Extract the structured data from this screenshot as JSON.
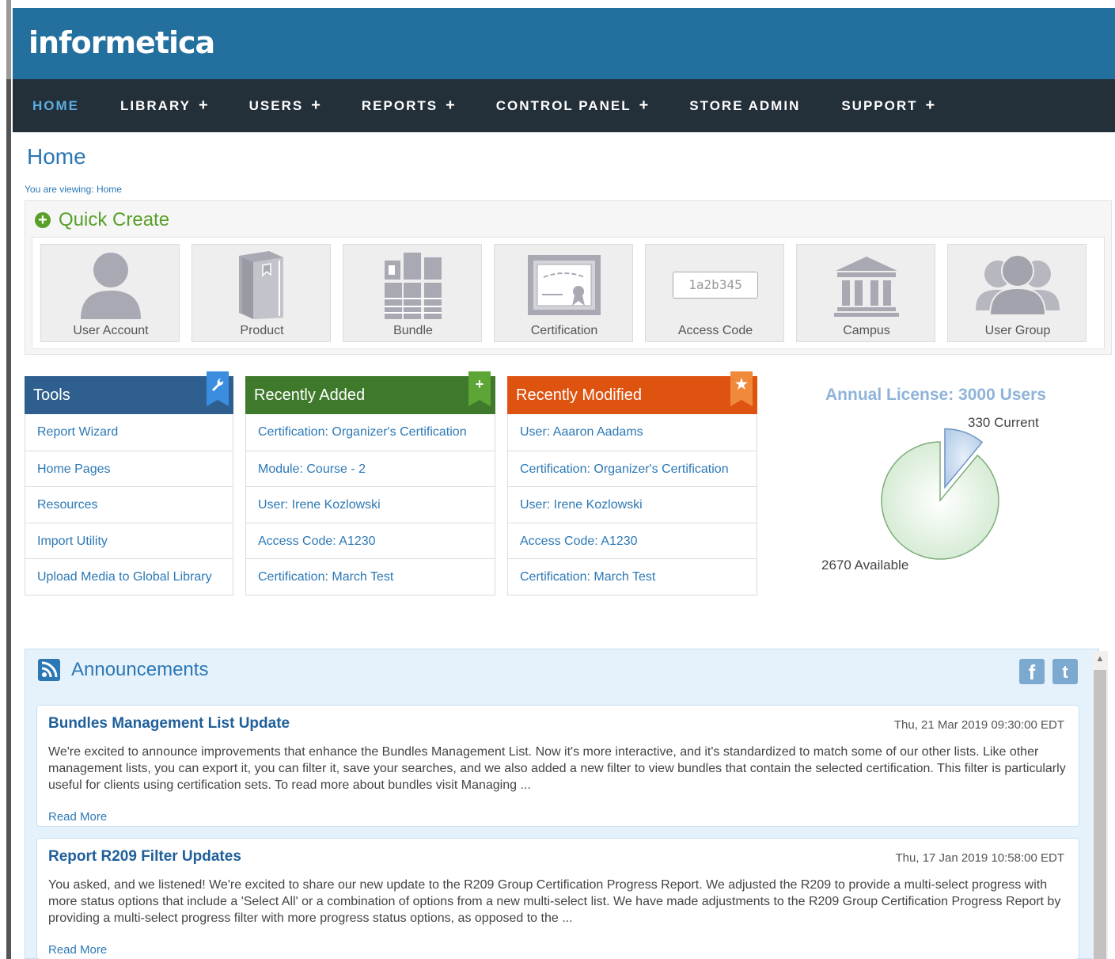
{
  "brand": {
    "logo": "informetica"
  },
  "nav": {
    "items": [
      {
        "label": "HOME",
        "plus": ""
      },
      {
        "label": "LIBRARY",
        "plus": "+"
      },
      {
        "label": "USERS",
        "plus": "+"
      },
      {
        "label": "REPORTS",
        "plus": "+"
      },
      {
        "label": "CONTROL PANEL",
        "plus": "+"
      },
      {
        "label": "STORE ADMIN",
        "plus": ""
      },
      {
        "label": "SUPPORT",
        "plus": "+"
      }
    ]
  },
  "page": {
    "title": "Home",
    "breadcrumb": "You are viewing: Home"
  },
  "quick_create": {
    "title": "Quick Create",
    "tiles": [
      {
        "label": "User Account",
        "icon": "user-account-icon"
      },
      {
        "label": "Product",
        "icon": "product-book-icon"
      },
      {
        "label": "Bundle",
        "icon": "bundle-icon"
      },
      {
        "label": "Certification",
        "icon": "certification-icon"
      },
      {
        "label": "Access Code",
        "icon": "access-code-icon",
        "sample_code": "1a2b345"
      },
      {
        "label": "Campus",
        "icon": "campus-icon"
      },
      {
        "label": "User Group",
        "icon": "user-group-icon"
      }
    ]
  },
  "tools": {
    "title": "Tools",
    "icon": "wrench-icon",
    "color": "#2e5f8f",
    "items": [
      "Report Wizard",
      "Home Pages",
      "Resources",
      "Import Utility",
      "Upload Media to Global Library"
    ]
  },
  "recently_added": {
    "title": "Recently Added",
    "icon": "plus-icon",
    "color": "#3f7a2c",
    "items": [
      "Certification: Organizer's Certification",
      "Module: Course - 2",
      "User: Irene Kozlowski",
      "Access Code: A1230",
      "Certification: March Test"
    ]
  },
  "recently_modified": {
    "title": "Recently Modified",
    "icon": "star-icon",
    "color": "#de5310",
    "items": [
      "User: Aaaron Aadams",
      "Certification: Organizer's Certification",
      "User: Irene Kozlowski",
      "Access Code: A1230",
      "Certification: March Test"
    ]
  },
  "license": {
    "title": "Annual License: 3000 Users",
    "current_label": "330 Current",
    "available_label": "2670 Available"
  },
  "chart_data": {
    "type": "pie",
    "title": "Annual License: 3000 Users",
    "slices": [
      {
        "label": "Current",
        "value": 330,
        "color": "#c6d9ee"
      },
      {
        "label": "Available",
        "value": 2670,
        "color": "#e3f1e2"
      }
    ]
  },
  "announcements": {
    "title": "Announcements",
    "social": [
      "facebook-icon",
      "twitter-icon"
    ],
    "social_glyphs": {
      "facebook": "f",
      "twitter": "t"
    },
    "items": [
      {
        "title": "Bundles Management List Update",
        "date": "Thu, 21 Mar 2019 09:30:00 EDT",
        "body": "We're excited to announce improvements that enhance the Bundles Management List. Now it's more interactive, and it's standardized to match some of our other lists. Like other management lists, you can export it, you can filter it, save your searches, and we also added a new filter to view bundles that contain the selected certification. This filter is particularly useful for clients using certification sets. To read more about bundles visit Managing ...",
        "read_more": "Read More"
      },
      {
        "title": "Report R209 Filter Updates",
        "date": "Thu, 17 Jan 2019 10:58:00 EDT",
        "body": "You asked, and we listened! We're excited to share our new update to the R209 Group Certification Progress Report. We adjusted the R209 to provide a multi-select progress with more status options that include a 'Select All' or a combination of options from a new multi-select list. We have made adjustments to the R209 Group Certification Progress Report by providing a multi-select progress filter with more progress status options, as opposed to the ...",
        "read_more": "Read More"
      }
    ]
  }
}
